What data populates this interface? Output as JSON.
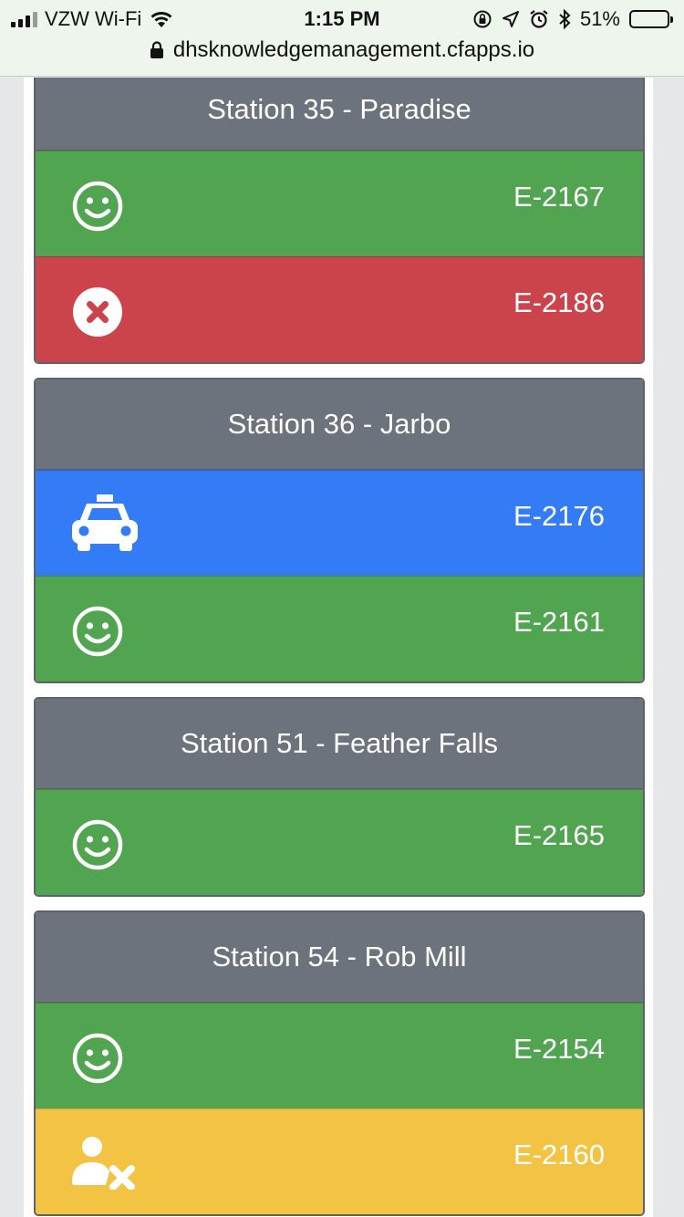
{
  "status_bar": {
    "carrier": "VZW Wi-Fi",
    "time": "1:15 PM",
    "battery": "51%",
    "battery_level": 0.51
  },
  "url_bar": {
    "url": "dhsknowledgemanagement.cfapps.io"
  },
  "colors": {
    "green": "#52a550",
    "red": "#cc444b",
    "blue": "#337cf6",
    "yellow": "#f3c343",
    "header": "#6c737c"
  },
  "stations": [
    {
      "name": "Station 35 - Paradise",
      "units": [
        {
          "id": "E-2167",
          "status_icon": "smiley-icon",
          "color": "green"
        },
        {
          "id": "E-2186",
          "status_icon": "x-circle-icon",
          "color": "red"
        }
      ]
    },
    {
      "name": "Station 36 - Jarbo",
      "units": [
        {
          "id": "E-2176",
          "status_icon": "taxi-icon",
          "color": "blue"
        },
        {
          "id": "E-2161",
          "status_icon": "smiley-icon",
          "color": "green"
        }
      ]
    },
    {
      "name": "Station 51 - Feather Falls",
      "units": [
        {
          "id": "E-2165",
          "status_icon": "smiley-icon",
          "color": "green"
        }
      ]
    },
    {
      "name": "Station 54 - Rob Mill",
      "units": [
        {
          "id": "E-2154",
          "status_icon": "smiley-icon",
          "color": "green"
        },
        {
          "id": "E-2160",
          "status_icon": "user-x-icon",
          "color": "yellow"
        }
      ]
    }
  ]
}
